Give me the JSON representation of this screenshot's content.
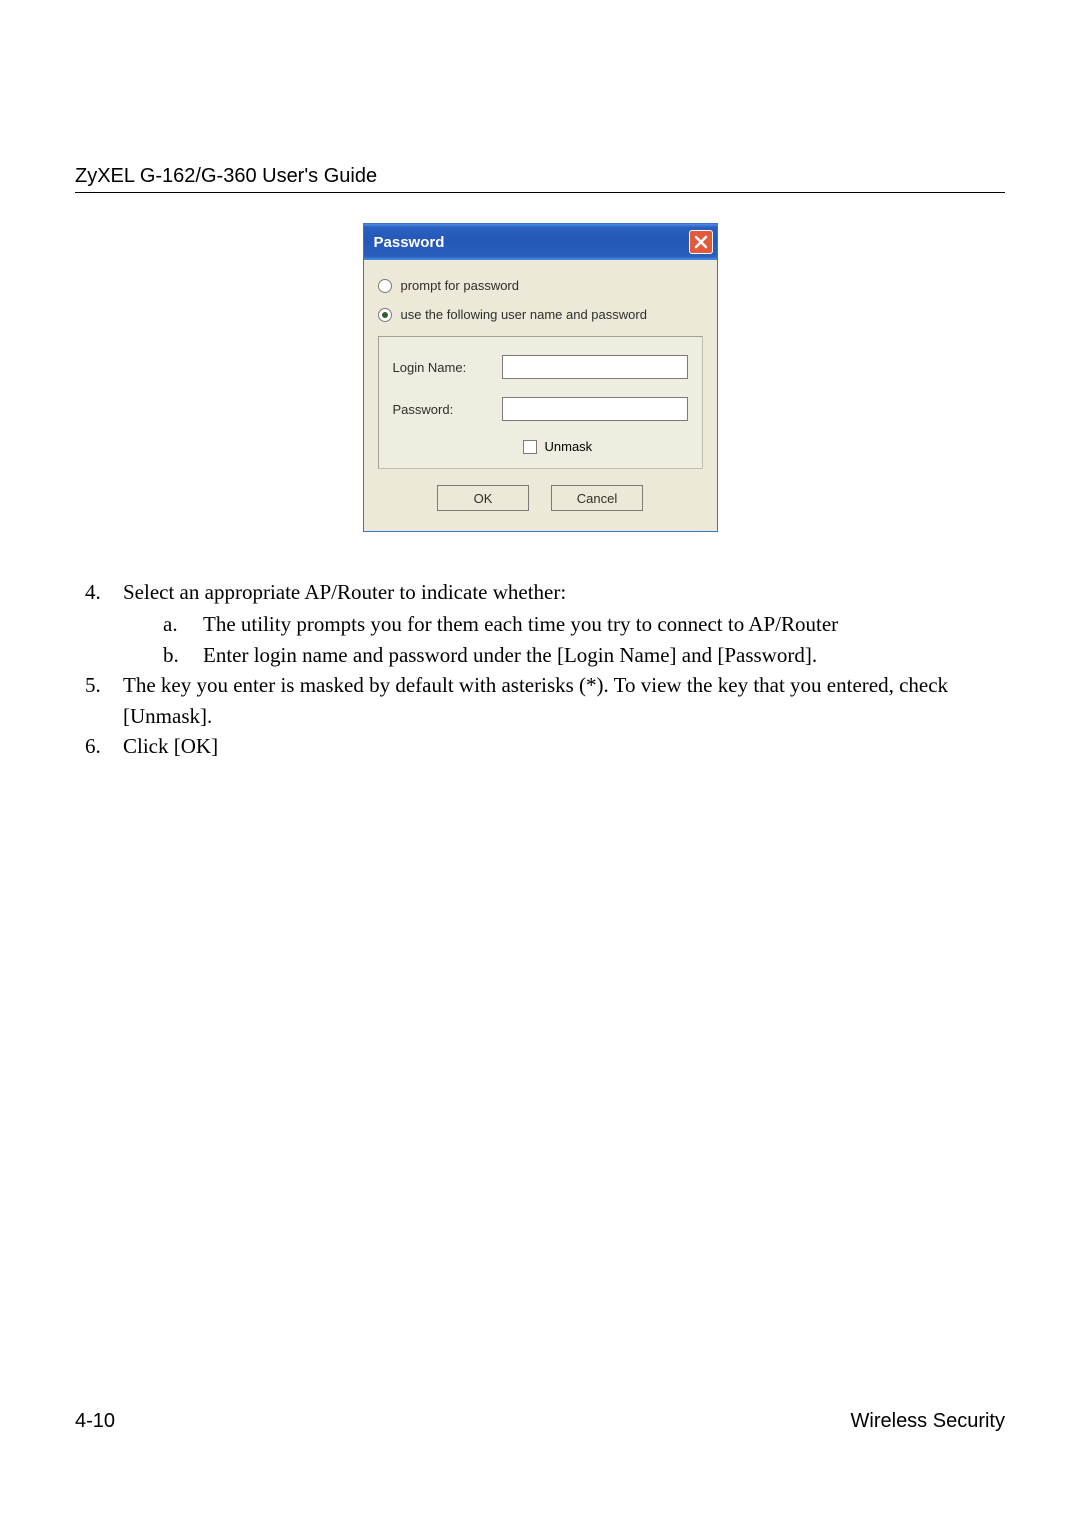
{
  "header": {
    "title": "ZyXEL G-162/G-360 User's Guide"
  },
  "dialog": {
    "title": "Password",
    "radio1_label": "prompt for password",
    "radio2_label": "use the following user name and password",
    "login_label": "Login Name:",
    "password_label": "Password:",
    "unmask_label": "Unmask",
    "ok_label": "OK",
    "cancel_label": "Cancel",
    "login_value": "",
    "password_value": ""
  },
  "instructions": {
    "items": [
      {
        "num": "4.",
        "text": "Select an appropriate AP/Router to indicate whether:",
        "sub": [
          {
            "alpha": "a.",
            "text": "The utility prompts you for them each time you try to connect to AP/Router"
          },
          {
            "alpha": "b.",
            "text": "Enter login name and password under the [Login Name] and [Password]."
          }
        ]
      },
      {
        "num": "5.",
        "text": "The key you enter is masked by default with asterisks (*).  To view the key that you entered, check [Unmask]."
      },
      {
        "num": "6.",
        "text": "Click [OK]"
      }
    ]
  },
  "footer": {
    "page_num": "4-10",
    "section": "Wireless Security"
  }
}
